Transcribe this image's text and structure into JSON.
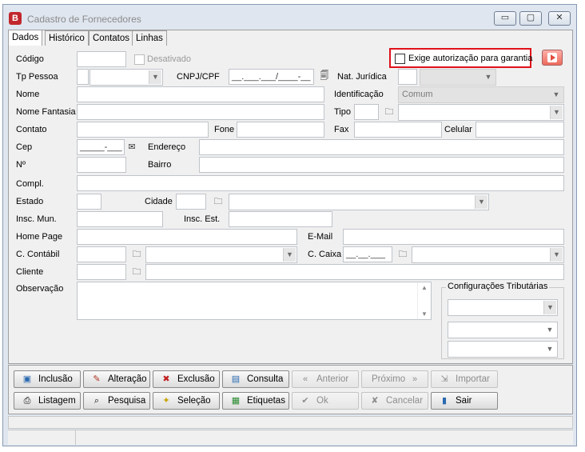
{
  "window": {
    "title": "Cadastro de Fornecedores",
    "icon_letter": "B",
    "min": "▭",
    "max": "▢",
    "close": "✕"
  },
  "tabs": [
    "Dados",
    "Histórico",
    "Contatos",
    "Linhas"
  ],
  "fields": {
    "codigo": "Código",
    "desativado": "Desativado",
    "exige": "Exige autorização para garantia",
    "tp_pessoa": "Tp Pessoa",
    "cnpj": "CNPJ/CPF",
    "cnpj_mask": "__.___.___/____-__",
    "nat_juridica": "Nat. Jurídica",
    "nome": "Nome",
    "identificacao": "Identificação",
    "identificacao_value": "Comum",
    "nome_fantasia": "Nome Fantasia",
    "tipo": "Tipo",
    "contato": "Contato",
    "fone": "Fone",
    "fax": "Fax",
    "celular": "Celular",
    "cep": "Cep",
    "cep_mask": "_____-___",
    "endereco": "Endereço",
    "numero": "Nº",
    "bairro": "Bairro",
    "compl": "Compl.",
    "estado": "Estado",
    "cidade": "Cidade",
    "insc_mun": "Insc. Mun.",
    "insc_est": "Insc. Est.",
    "home_page": "Home Page",
    "email": "E-Mail",
    "c_contabil": "C. Contábil",
    "c_caixa": "C. Caixa",
    "c_caixa_mask": "__.__.___",
    "cliente": "Cliente",
    "observacao": "Observação",
    "config_trib": "Configurações Tributárias"
  },
  "buttons": {
    "inclusao": "Inclusão",
    "alteracao": "Alteração",
    "exclusao": "Exclusão",
    "consulta": "Consulta",
    "anterior": "Anterior",
    "proximo": "Próximo",
    "importar": "Importar",
    "listagem": "Listagem",
    "pesquisa": "Pesquisa",
    "selecao": "Seleção",
    "etiquetas": "Etiquetas",
    "ok": "Ok",
    "cancelar": "Cancelar",
    "sair": "Sair"
  },
  "accent": {
    "highlight_border": "#e0101a",
    "title_icon": "#c1272d",
    "video_button": "#ee6a5e"
  }
}
